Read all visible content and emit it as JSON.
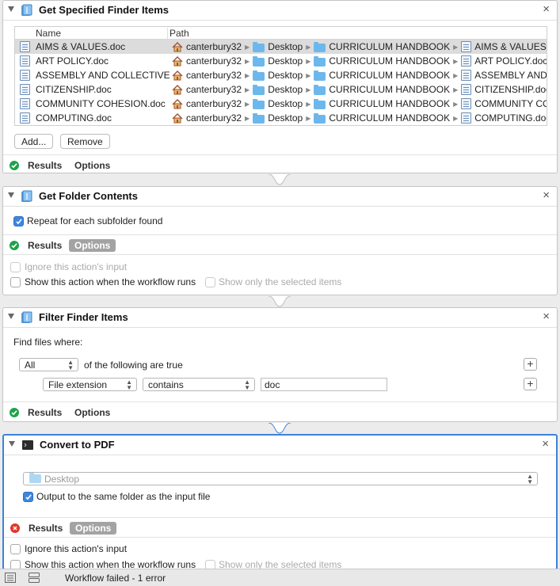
{
  "actions": [
    {
      "title": "Get Specified Finder Items",
      "footer": {
        "results": "Results",
        "options": "Options",
        "status": "success"
      },
      "columns": {
        "name": "Name",
        "path": "Path"
      },
      "files": [
        {
          "name": "AIMS & VALUES.doc",
          "path": [
            "canterbury32",
            "Desktop",
            "CURRICULUM HANDBOOK",
            "AIMS & VALUES.doc"
          ]
        },
        {
          "name": "ART POLICY.doc",
          "path": [
            "canterbury32",
            "Desktop",
            "CURRICULUM HANDBOOK",
            "ART POLICY.doc"
          ]
        },
        {
          "name": "ASSEMBLY AND COLLECTIVE",
          "path": [
            "canterbury32",
            "Desktop",
            "CURRICULUM HANDBOOK",
            "ASSEMBLY AND COLLECTIVE"
          ]
        },
        {
          "name": "CITIZENSHIP.doc",
          "path": [
            "canterbury32",
            "Desktop",
            "CURRICULUM HANDBOOK",
            "CITIZENSHIP.doc"
          ]
        },
        {
          "name": "COMMUNITY COHESION.doc",
          "path": [
            "canterbury32",
            "Desktop",
            "CURRICULUM HANDBOOK",
            "COMMUNITY COHESION.doc"
          ]
        },
        {
          "name": "COMPUTING.doc",
          "path": [
            "canterbury32",
            "Desktop",
            "CURRICULUM HANDBOOK",
            "COMPUTING.doc"
          ]
        }
      ],
      "add_button": "Add...",
      "remove_button": "Remove"
    },
    {
      "title": "Get Folder Contents",
      "repeat_label": "Repeat for each subfolder found",
      "footer": {
        "results": "Results",
        "options": "Options",
        "status": "success"
      },
      "ignore_input": "Ignore this action's input",
      "show_action": "Show this action when the workflow runs",
      "show_selected": "Show only the selected items"
    },
    {
      "title": "Filter Finder Items",
      "find_label": "Find files where:",
      "match_popup": "All",
      "match_suffix": "of the following are true",
      "criteria": {
        "attribute": "File extension",
        "operator": "contains",
        "value": "doc"
      },
      "footer": {
        "results": "Results",
        "options": "Options",
        "status": "success"
      }
    },
    {
      "title": "Convert to PDF",
      "folder_popup": "Desktop",
      "same_folder": "Output to the same folder as the input file",
      "footer": {
        "results": "Results",
        "options": "Options",
        "status": "error"
      },
      "ignore_input": "Ignore this action's input",
      "show_action": "Show this action when the workflow runs",
      "show_selected": "Show only the selected items"
    }
  ],
  "statusbar": {
    "message": "Workflow failed - 1 error"
  },
  "colors": {
    "accent": "#3f82d8",
    "success": "#1ea34b",
    "error": "#e0362c",
    "folder": "#6cb8ec"
  }
}
